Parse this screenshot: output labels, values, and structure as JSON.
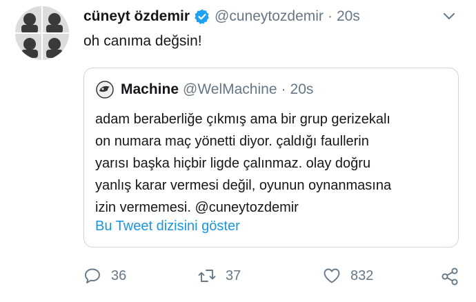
{
  "tweet": {
    "display_name": "cüneyt özdemir",
    "verified": true,
    "handle": "@cuneytozdemir",
    "separator": "·",
    "time": "20s",
    "text": "oh canıma değsin!",
    "quote": {
      "display_name": "Machine",
      "handle": "@WelMachine",
      "separator": "·",
      "time": "20s",
      "lines": [
        "adam beraberliğe çıkmış ama bir grup gerizekalı",
        "on numara maç yönetti diyor. çaldığı faullerin",
        "yarısı başka hiçbir ligde çalınmaz. olay doğru",
        "yanlış karar vermesi değil, oyunun oynanmasına",
        "izin vermemesi. @cuneytozdemir"
      ],
      "show_thread": "Bu Tweet dizisini göster"
    },
    "actions": {
      "replies": "36",
      "retweets": "37",
      "likes": "832"
    }
  },
  "icons": {
    "verified": "verified-badge-icon",
    "more": "chevron-down-icon",
    "reply": "reply-icon",
    "retweet": "retweet-icon",
    "like": "heart-icon",
    "share": "share-icon"
  },
  "colors": {
    "primary_text": "#14171a",
    "secondary_text": "#657786",
    "link": "#1b95e0",
    "verified": "#1da1f2",
    "border": "#ccd6dd"
  }
}
